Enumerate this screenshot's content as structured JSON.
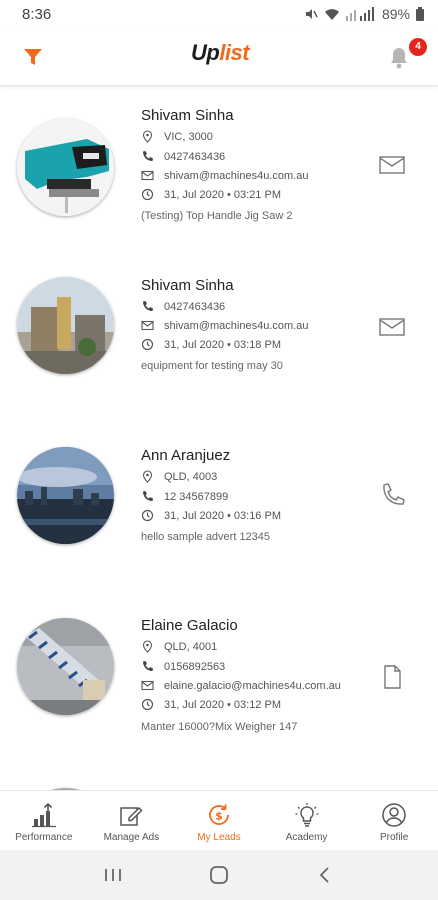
{
  "status_bar": {
    "time": "8:36",
    "battery": "89%"
  },
  "header": {
    "logo_up": "Up",
    "logo_list": "list",
    "notification_count": "4"
  },
  "leads": [
    {
      "name": "Shivam Sinha",
      "location": "VIC, 3000",
      "phone": "0427463436",
      "email": "shivam@machines4u.com.au",
      "date": "31, Jul 2020 • 03:21 PM",
      "description": "(Testing) Top Handle Jig Saw 2",
      "action_icon": "mail-icon"
    },
    {
      "name": "Shivam Sinha",
      "phone": "0427463436",
      "email": "shivam@machines4u.com.au",
      "date": "31, Jul 2020 • 03:18 PM",
      "description": "equipment for testing may 30",
      "action_icon": "mail-icon"
    },
    {
      "name": "Ann Aranjuez",
      "location": "QLD, 4003",
      "phone": "12 34567899",
      "date": "31, Jul 2020 • 03:16 PM",
      "description": "hello sample advert 12345",
      "action_icon": "phone-icon"
    },
    {
      "name": "Elaine Galacio",
      "location": "QLD, 4001",
      "phone": "0156892563",
      "email": "elaine.galacio@machines4u.com.au",
      "date": "31, Jul 2020 • 03:12 PM",
      "description": "Manter 16000?Mix Weigher 147",
      "action_icon": "document-icon"
    }
  ],
  "bottom_nav": [
    {
      "label": "Performance",
      "icon": "performance-icon"
    },
    {
      "label": "Manage Ads",
      "icon": "edit-icon"
    },
    {
      "label": "My Leads",
      "icon": "dollar-refresh-icon",
      "active": true
    },
    {
      "label": "Academy",
      "icon": "lightbulb-icon"
    },
    {
      "label": "Profile",
      "icon": "profile-icon"
    }
  ],
  "colors": {
    "accent": "#f26a1b",
    "badge": "#e3261d"
  }
}
